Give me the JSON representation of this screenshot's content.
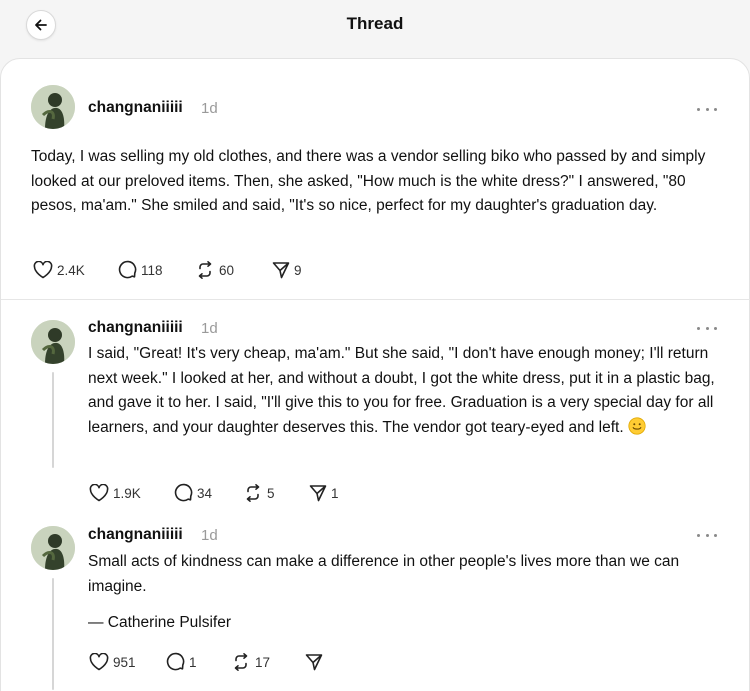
{
  "header": {
    "title": "Thread"
  },
  "posts": [
    {
      "username": "changnaniiiii",
      "time": "1d",
      "paragraphs": [
        "Today, I was selling my old clothes, and there was a vendor selling biko who passed by and simply looked at our preloved items. Then, she asked, \"How much is the white dress?\" I answered, \"80 pesos, ma'am.\" She smiled and said, \"It's so nice, perfect for my daughter's graduation day."
      ],
      "likes": "2.4K",
      "replies": "118",
      "reposts": "60",
      "shares": "9"
    },
    {
      "username": "changnaniiiii",
      "time": "1d",
      "paragraphs": [
        "I said, \"Great! It's very cheap, ma'am.\" But she said, \"I don't have enough money; I'll return next week.\" I looked at her, and without a doubt, I got the white dress, put it in a plastic bag, and gave it to her. I said, \"I'll give this to you for free. Graduation is a very special day for all learners, and your daughter deserves this. The vendor got teary-eyed and left. "
      ],
      "emoji": "smiling-face-emoji",
      "likes": "1.9K",
      "replies": "34",
      "reposts": "5",
      "shares": "1"
    },
    {
      "username": "changnaniiiii",
      "time": "1d",
      "paragraphs": [
        "Small acts of kindness can make a difference in other people's lives more than we can imagine."
      ],
      "attribution": "— Catherine Pulsifer",
      "likes": "951",
      "replies": "1",
      "reposts": "17",
      "shares": ""
    }
  ],
  "icons": {
    "back": "arrow-left-icon",
    "more": "more-horizontal-icon",
    "like": "heart-icon",
    "reply": "comment-icon",
    "repost": "repost-icon",
    "share": "send-icon"
  }
}
